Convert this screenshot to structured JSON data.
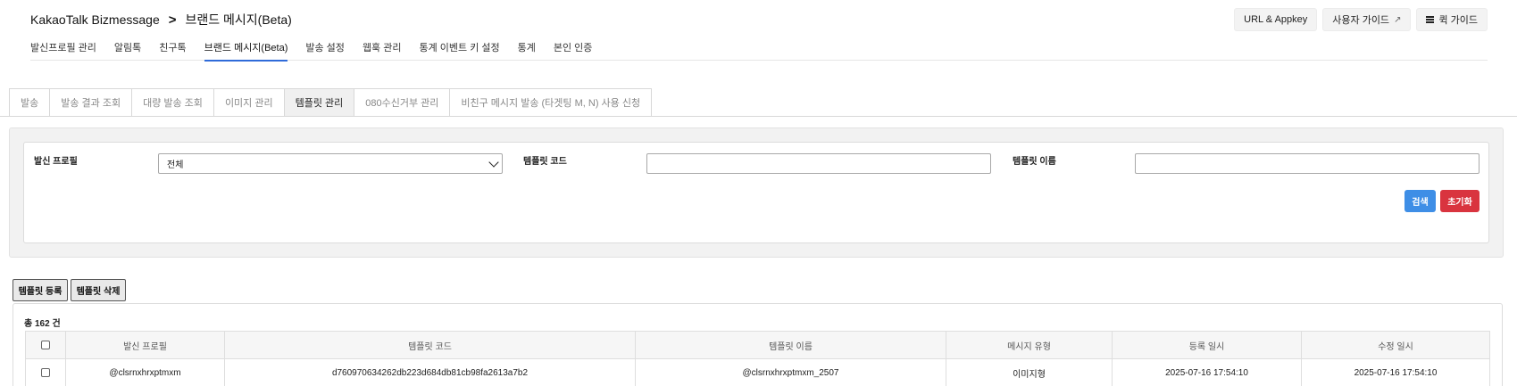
{
  "header": {
    "breadcrumb": [
      "KakaoTalk Bizmessage",
      "브랜드 메시지(Beta)"
    ],
    "breadcrumb_sep": ">",
    "nav": [
      {
        "label": "발신프로필 관리",
        "active": false
      },
      {
        "label": "알림톡",
        "active": false
      },
      {
        "label": "친구톡",
        "active": false
      },
      {
        "label": "브랜드 메시지(Beta)",
        "active": true
      },
      {
        "label": "발송 설정",
        "active": false
      },
      {
        "label": "웹훅 관리",
        "active": false
      },
      {
        "label": "통계 이벤트 키 설정",
        "active": false
      },
      {
        "label": "통계",
        "active": false
      },
      {
        "label": "본인 인증",
        "active": false
      }
    ],
    "buttons": {
      "url_appkey": "URL & Appkey",
      "user_guide": "사용자 가이드",
      "quick_guide": "퀵 가이드"
    }
  },
  "tabs": [
    {
      "label": "발송",
      "active": false
    },
    {
      "label": "발송 결과 조회",
      "active": false
    },
    {
      "label": "대량 발송 조회",
      "active": false
    },
    {
      "label": "이미지 관리",
      "active": false
    },
    {
      "label": "템플릿 관리",
      "active": true
    },
    {
      "label": "080수신거부 관리",
      "active": false
    },
    {
      "label": "비친구 메시지 발송 (타겟팅 M, N) 사용 신청",
      "active": false
    }
  ],
  "search": {
    "sender_profile_label": "발신 프로필",
    "sender_profile_value": "전체",
    "template_code_label": "템플릿 코드",
    "template_code_value": "",
    "template_name_label": "템플릿 이름",
    "template_name_value": "",
    "search_button": "검색",
    "reset_button": "초기화"
  },
  "actions": {
    "register": "템플릿 등록",
    "delete": "템플릿 삭제"
  },
  "results": {
    "count_text": "총 162 건",
    "columns": [
      "발신 프로필",
      "템플릿 코드",
      "템플릿 이름",
      "메시지 유형",
      "등록 일시",
      "수정 일시"
    ],
    "rows": [
      {
        "sender_profile": "@clsrnxhrxptmxm",
        "template_code": "d760970634262db223d684db81cb98fa2613a7b2",
        "template_name": "@clsrnxhrxptmxm_2507",
        "message_type": "이미지형",
        "created_at": "2025-07-16 17:54:10",
        "updated_at": "2025-07-16 17:54:10"
      }
    ]
  },
  "colors": {
    "accent": "#2f6bd9",
    "search_button": "#3e8ee6",
    "reset_button": "#d9343f"
  }
}
